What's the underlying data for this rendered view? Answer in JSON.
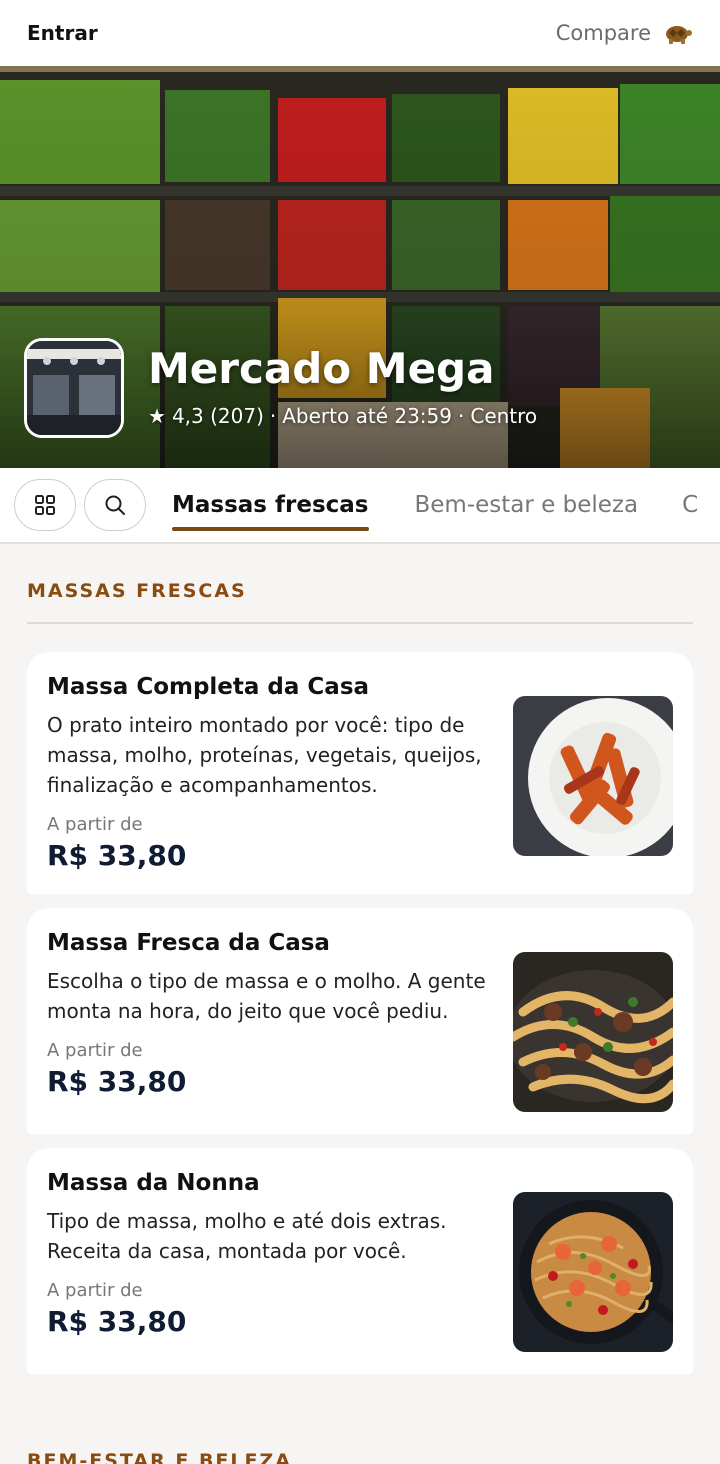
{
  "topbar": {
    "login_label": "Entrar",
    "compare_label": "Compare",
    "compare_icon": "turtle-icon"
  },
  "store": {
    "name": "Mercado Mega",
    "rating": "4,3 (207)",
    "separator": "·",
    "hours": "Aberto até 23:59",
    "area": "Centro"
  },
  "tabs": {
    "items": [
      {
        "label": "Massas frescas"
      },
      {
        "label": "Bem-estar e beleza"
      },
      {
        "label": "C"
      }
    ]
  },
  "sections": [
    {
      "title": "MASSAS FRESCAS",
      "items": [
        {
          "title": "Massa Completa da Casa",
          "desc": "O prato inteiro montado por você: tipo de massa, molho, proteínas, vegetais, queijos, finalização e acompanhamentos.",
          "price_label": "A partir de",
          "price": "R$ 33,80"
        },
        {
          "title": "Massa Fresca da Casa",
          "desc": "Escolha o tipo de massa e o molho. A gente monta na hora, do jeito que você pediu.",
          "price_label": "A partir de",
          "price": "R$ 33,80"
        },
        {
          "title": "Massa da Nonna",
          "desc": "Tipo de massa, molho e até dois extras. Receita da casa, montada por você.",
          "price_label": "A partir de",
          "price": "R$ 33,80"
        }
      ]
    },
    {
      "title": "BEM-ESTAR E BELEZA"
    }
  ],
  "colors": {
    "accent": "#8a4b10",
    "price": "#0f1c33",
    "background": "#f6f5f3"
  }
}
